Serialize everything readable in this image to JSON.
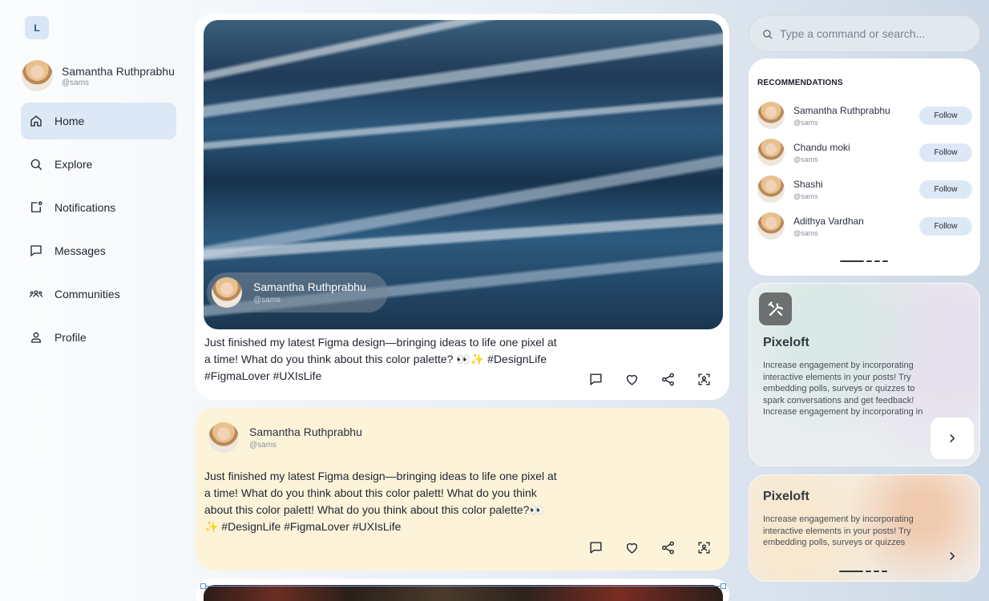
{
  "app": {
    "logo_letter": "L"
  },
  "user": {
    "name": "Samantha Ruthprabhu",
    "handle": "@sams"
  },
  "nav": [
    {
      "label": "Home",
      "icon": "home-icon",
      "active": true
    },
    {
      "label": "Explore",
      "icon": "search-icon"
    },
    {
      "label": "Notifications",
      "icon": "notification-icon"
    },
    {
      "label": "Messages",
      "icon": "message-icon"
    },
    {
      "label": "Communities",
      "icon": "communities-icon"
    },
    {
      "label": "Profile",
      "icon": "profile-icon"
    }
  ],
  "posts": [
    {
      "author": {
        "name": "Samantha Ruthprabhu",
        "handle": "@sams"
      },
      "text": "Just finished my latest Figma design—bringing ideas to life one pixel at a time! What do you think about this color palette? 👀✨ #DesignLife #FigmaLover #UXIsLife"
    },
    {
      "author": {
        "name": "Samantha Ruthprabhu",
        "handle": "@sams"
      },
      "text": "Just finished my latest Figma design—bringing ideas to life one pixel at a time! What do you think about this color palett! What do you think about this color palett! What do you think about this color palette?👀✨ #DesignLife #FigmaLover #UXIsLife"
    }
  ],
  "search": {
    "placeholder": "Type a command or search..."
  },
  "recommendations": {
    "title": "RECOMMENDATIONS",
    "follow_label": "Follow",
    "people": [
      {
        "name": "Samantha Ruthprabhu",
        "handle": "@sams"
      },
      {
        "name": "Chandu moki",
        "handle": "@sams"
      },
      {
        "name": "Shashi",
        "handle": "@sams"
      },
      {
        "name": "Adithya Vardhan",
        "handle": "@sams"
      }
    ]
  },
  "promos": [
    {
      "title": "Pixeloft",
      "body": "Increase engagement by incorporating interactive elements in your posts! Try embedding polls, surveys or quizzes to spark conversations and get feedback! Increase engagement by incorporating in"
    },
    {
      "title": "Pixeloft",
      "body": "Increase engagement by incorporating interactive elements in your posts! Try embedding polls, surveys or quizzes"
    }
  ],
  "colors": {
    "accent": "#dde8f7",
    "post_highlight": "#fdf3d9"
  }
}
